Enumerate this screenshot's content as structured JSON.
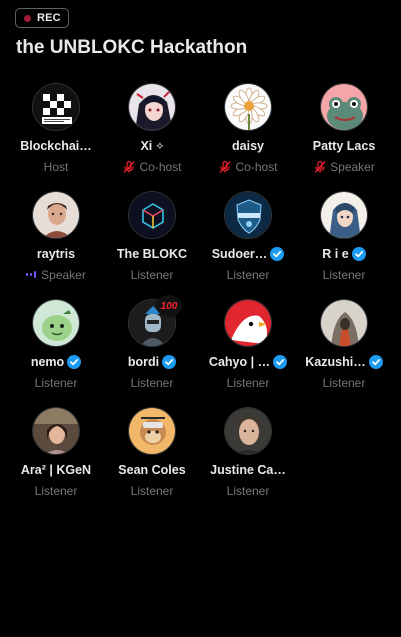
{
  "rec": {
    "label": "REC"
  },
  "space": {
    "title": "the UNBLOKC Hackathon"
  },
  "colors": {
    "background": "#000000",
    "muted_text": "#71767b",
    "verified_blue": "#1d9bf0",
    "speaking_purple": "#7856ff",
    "mic_off_red": "#f4212e",
    "rec_dot": "#a31b3a"
  },
  "participants": [
    {
      "name": "Blockchai…",
      "role": "Host",
      "verified": false,
      "mic": "none",
      "avatar": "checker-logo"
    },
    {
      "name": "Xi",
      "name_suffix": "⟡",
      "role": "Co-host",
      "verified": false,
      "mic": "muted",
      "avatar": "anime-girl"
    },
    {
      "name": "daisy",
      "role": "Co-host",
      "verified": false,
      "mic": "muted",
      "avatar": "daisy-flower"
    },
    {
      "name": "Patty Lacs",
      "role": "Speaker",
      "verified": false,
      "mic": "muted",
      "avatar": "pink-frog"
    },
    {
      "name": "raytris",
      "role": "Speaker",
      "verified": false,
      "mic": "speaking",
      "avatar": "man-portrait"
    },
    {
      "name": "The BLOKC",
      "role": "Listener",
      "verified": false,
      "mic": "none",
      "avatar": "cube-logo"
    },
    {
      "name": "Sudoer…",
      "role": "Listener",
      "verified": true,
      "mic": "none",
      "avatar": "shield-logo"
    },
    {
      "name": "R i e",
      "role": "Listener",
      "verified": true,
      "mic": "none",
      "avatar": "anime-blue-hair"
    },
    {
      "name": "nemo",
      "role": "Listener",
      "verified": true,
      "mic": "none",
      "avatar": "green-character"
    },
    {
      "name": "bordi",
      "role": "Listener",
      "verified": true,
      "mic": "none",
      "avatar": "robot-100",
      "emoji": "100"
    },
    {
      "name": "Cahyo | …",
      "role": "Listener",
      "verified": true,
      "mic": "none",
      "avatar": "red-bird"
    },
    {
      "name": "Kazushi…",
      "role": "Listener",
      "verified": true,
      "mic": "none",
      "avatar": "hooded-figure"
    },
    {
      "name": "Ara² | KGeN",
      "role": "Listener",
      "verified": false,
      "mic": "none",
      "avatar": "photo-portrait"
    },
    {
      "name": "Sean Coles",
      "role": "Listener",
      "verified": false,
      "mic": "none",
      "avatar": "monkey-nft"
    },
    {
      "name": "Justine Ca…",
      "role": "Listener",
      "verified": false,
      "mic": "none",
      "avatar": "man-photo"
    }
  ]
}
